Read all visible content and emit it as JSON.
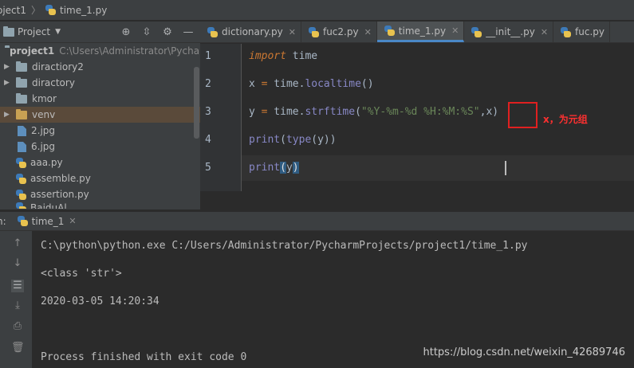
{
  "navbar": {
    "project": "oject1",
    "file": "time_1.py"
  },
  "project_panel": {
    "title": "Project",
    "tools": [
      "target-icon",
      "collapse-icon",
      "gear-icon",
      "minimize-icon"
    ],
    "root": {
      "name": "project1",
      "path": "C:\\Users\\Administrator\\Pycharm"
    },
    "items": [
      {
        "name": "diractiory2",
        "type": "folder",
        "expandable": true
      },
      {
        "name": "diractory",
        "type": "folder",
        "expandable": true
      },
      {
        "name": "kmor",
        "type": "folder",
        "expandable": false
      },
      {
        "name": "venv",
        "type": "folder-excluded",
        "expandable": true
      },
      {
        "name": "2.jpg",
        "type": "file"
      },
      {
        "name": "6.jpg",
        "type": "file"
      },
      {
        "name": "aaa.py",
        "type": "file"
      },
      {
        "name": "assemble.py",
        "type": "file"
      },
      {
        "name": "assertion.py",
        "type": "file"
      },
      {
        "name": "BaiduAl...",
        "type": "file"
      }
    ]
  },
  "editor_tabs": [
    {
      "label": "dictionary.py",
      "active": false
    },
    {
      "label": "fuc2.py",
      "active": false
    },
    {
      "label": "time_1.py",
      "active": true
    },
    {
      "label": "__init__.py",
      "active": false
    },
    {
      "label": "fuc.py",
      "active": false
    }
  ],
  "editor": {
    "line_numbers": [
      "1",
      "2",
      "3",
      "4",
      "5"
    ],
    "lines": {
      "l1_kw": "import",
      "l1_rest": " time",
      "l2_a": "x ",
      "l2_eq": "=",
      "l2_b": " time.",
      "l2_fn": "localtime",
      "l2_c": "()",
      "l3_a": "y ",
      "l3_eq": "=",
      "l3_b": " time.",
      "l3_fn": "strftime",
      "l3_c": "(",
      "l3_str": "\"%Y-%m-%d %H:%M:%S\"",
      "l3_d": ",x)",
      "l4_a": "print",
      "l4_b": "(",
      "l4_c": "type",
      "l4_d": "(y))",
      "l5_a": "print",
      "l5_b": "(",
      "l5_c": "y",
      "l5_d": ")"
    },
    "annotation": "x，为元组"
  },
  "run": {
    "label": "n:",
    "tab": "time_1",
    "output": [
      "C:\\python\\python.exe C:/Users/Administrator/PycharmProjects/project1/time_1.py",
      "<class 'str'>",
      "2020-03-05 14:20:34",
      "",
      "Process finished with exit code 0"
    ],
    "toolbar_icons": [
      "up-arrow-icon",
      "down-arrow-icon",
      "soft-wrap-icon",
      "scroll-to-end-icon",
      "print-icon",
      "trash-icon"
    ]
  },
  "watermark": "https://blog.csdn.net/weixin_42689746",
  "colors": {
    "accent": "#4a88c7",
    "keyword": "#cc7832",
    "string": "#6a8759",
    "annotation": "#e02020"
  }
}
